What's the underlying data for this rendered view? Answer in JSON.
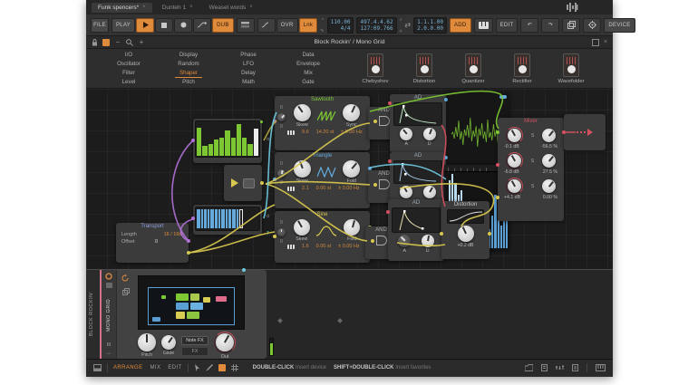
{
  "window": {
    "tabs": [
      {
        "label": "Funk spencers*",
        "active": true
      },
      {
        "label": "Dunteh 1",
        "active": false
      },
      {
        "label": "Weasel words",
        "active": false
      }
    ],
    "close_glyph": "×"
  },
  "toolbar": {
    "file": "FILE",
    "play_menu": "PLAY",
    "dub": "DUB",
    "ovr": "OVR",
    "lnk": "Lnk",
    "tempo": "110.00",
    "time_sig": "4/4",
    "position": "497.4.4.62",
    "time": "127:09.766",
    "loop_start": "1.1.1.00",
    "loop_length": "2.0.0.00",
    "add": "ADD",
    "edit": "EDIT",
    "device": "DEVICE"
  },
  "device_header": {
    "title": "Block Rockin' / Mono Grid",
    "zoom_out": "−",
    "zoom_in": "+"
  },
  "palette": {
    "categories": [
      "I/O",
      "Display",
      "Phase",
      "Data",
      "Oscillator",
      "Random",
      "LFO",
      "Envelope",
      "Filter",
      "Shaper",
      "Delay",
      "Mix",
      "Level",
      "Pitch",
      "Math",
      "Gate"
    ],
    "selected_category": "Shaper",
    "modules": [
      {
        "label": "Chebyshev"
      },
      {
        "label": "Distortion"
      },
      {
        "label": "Quantizer"
      },
      {
        "label": "Rectifier"
      },
      {
        "label": "Wavefolder"
      }
    ]
  },
  "canvas": {
    "steps": {
      "values": [
        0.85,
        0.3,
        0.35,
        0.5,
        0.55,
        0.75,
        0.55,
        0.95,
        0.55,
        0.35
      ],
      "playhead_value": 0.8,
      "out_label": "o"
    },
    "gates": {
      "widths": [
        4,
        2,
        3,
        2,
        4,
        3,
        2,
        4,
        2,
        3,
        4,
        2
      ],
      "out_label": "o",
      "trig_label": "T"
    },
    "transport": {
      "title": "Transport",
      "length_label": "Length",
      "length_value": "16 / 16th",
      "offset_label": "Offset",
      "offset_value": "0"
    },
    "sawtooth": {
      "title": "Sawtooth",
      "knob1": "Skew",
      "knob2": "Sync",
      "oct": "9.6",
      "semi": "14.20 st",
      "hz": "± 5.00 Hz"
    },
    "triangle": {
      "title": "Triangle",
      "knob1": "Skew",
      "knob2": "Fold",
      "oct": "2.1",
      "semi": "0.00 st",
      "hz": "± 0.00 Hz"
    },
    "sine": {
      "title": "Sine",
      "knob1": "Skew",
      "knob2": "Fold",
      "oct": "1.6",
      "semi": "0.00 st",
      "hz": "± 0.00 Hz"
    },
    "and_label": "AND",
    "ad": {
      "title": "AD",
      "knob_a": "A",
      "knob_d": "D"
    },
    "distortion": {
      "title": "Distortion",
      "value": "+0.2 dB"
    },
    "mixer": {
      "solo_label": "S",
      "channels": [
        {
          "gain": "-0.1 dB",
          "pan": "-56.5 %"
        },
        {
          "gain": "-6.8 dB",
          "pan": "27.5 %"
        },
        {
          "gain": "+4.1 dB",
          "pan": "0.00 %"
        }
      ]
    },
    "spectrum": {
      "values": [
        0.5,
        0.92,
        1.0,
        0.88,
        0.72,
        0.78,
        0.5,
        0.45,
        0.6,
        0.28,
        0.4,
        0.52,
        0.18,
        0.33,
        0.58,
        0.26,
        0.44,
        0.72,
        0.38,
        0.3,
        0.62,
        0.48
      ]
    }
  },
  "bottom": {
    "track_name": "BLOCK ROCKIN'",
    "device_name": "MONO GRID",
    "pitch_label": "Pitch",
    "glide_label": "Glide",
    "out_label": "Out",
    "note_fx": "Note FX",
    "fx": "FX"
  },
  "status_bar": {
    "views": [
      {
        "label": "ARRANGE",
        "active": true
      },
      {
        "label": "MIX",
        "active": false
      },
      {
        "label": "EDIT",
        "active": false
      }
    ],
    "hint1_key": "DOUBLE-CLICK",
    "hint1_text": "Insert device",
    "hint2_key": "SHIFT+DOUBLE-CLICK",
    "hint2_text": "Insert favorites"
  },
  "colors": {
    "accent": "#e08a3c",
    "green": "#7dc832",
    "blue": "#64aadc",
    "yellow": "#d8c84e",
    "red": "#d4505e",
    "purple": "#b070d8",
    "cyan": "#6ec8e0"
  }
}
